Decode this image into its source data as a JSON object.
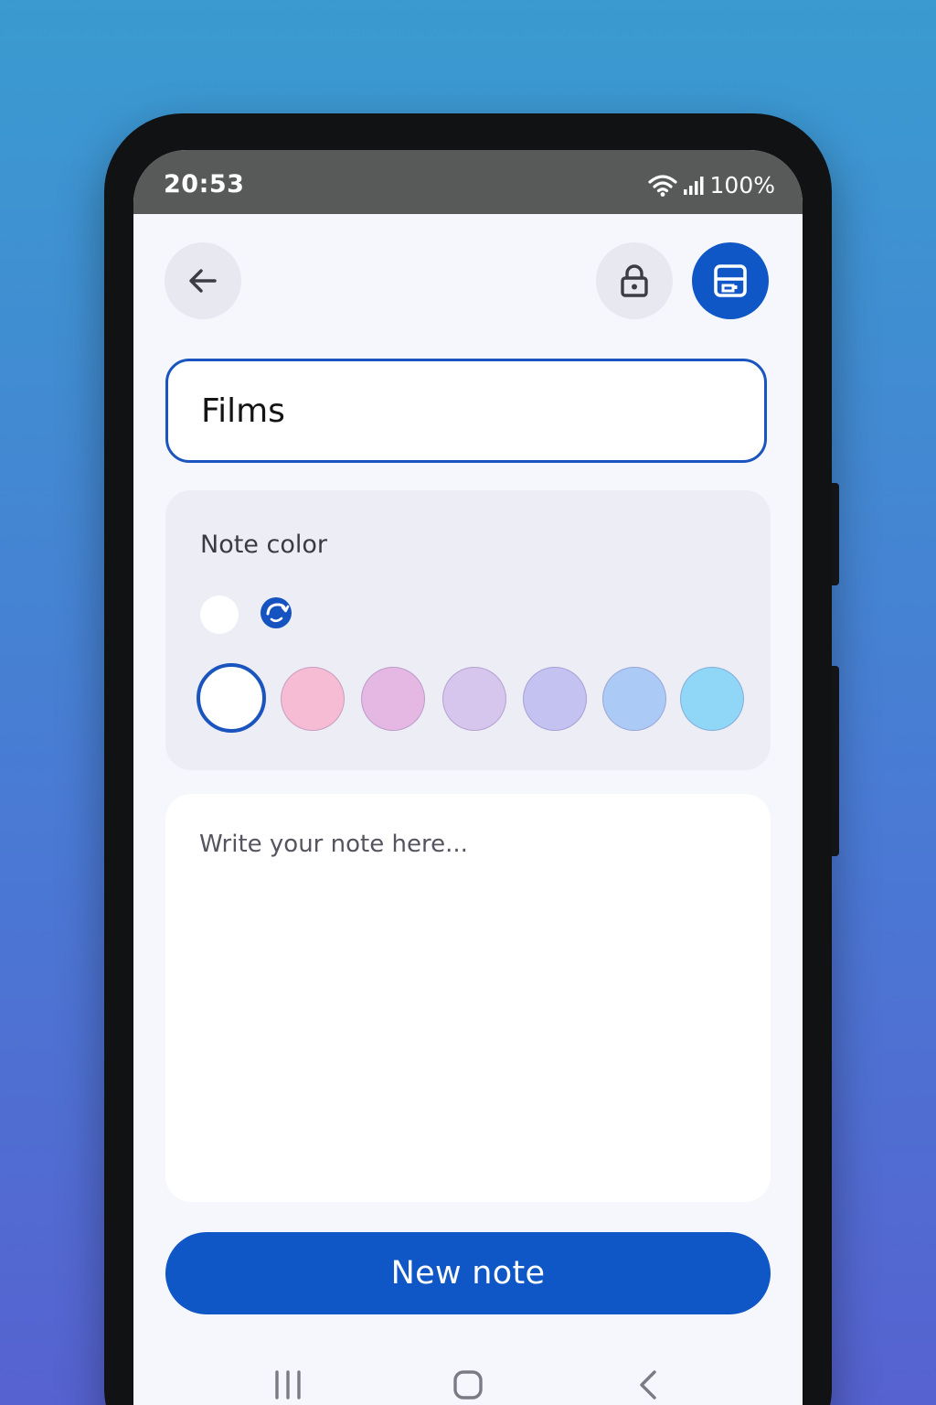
{
  "status_bar": {
    "time": "20:53",
    "battery": "100%",
    "icons": [
      "wifi-icon",
      "signal-icon"
    ]
  },
  "toolbar": {
    "back_icon": "arrow-left-icon",
    "lock_icon": "lock-icon",
    "save_icon": "save-icon"
  },
  "note": {
    "title_value": "Films",
    "body_placeholder": "Write your note here..."
  },
  "color_picker": {
    "label": "Note color",
    "swatches": [
      {
        "color": "#ffffff",
        "selected": true
      },
      {
        "color": "#f6bcd3",
        "selected": false
      },
      {
        "color": "#e4b8e3",
        "selected": false
      },
      {
        "color": "#d6c5ec",
        "selected": false
      },
      {
        "color": "#c4c2f1",
        "selected": false
      },
      {
        "color": "#abcaf6",
        "selected": false
      },
      {
        "color": "#8fd6f7",
        "selected": false
      }
    ]
  },
  "actions": {
    "new_note_label": "New note"
  },
  "colors": {
    "accent": "#0f57c6",
    "status_bar": "#575a59",
    "screen_bg": "#f6f7fc"
  },
  "nav": {
    "icons": [
      "recent-apps-icon",
      "home-icon",
      "back-nav-icon"
    ]
  }
}
